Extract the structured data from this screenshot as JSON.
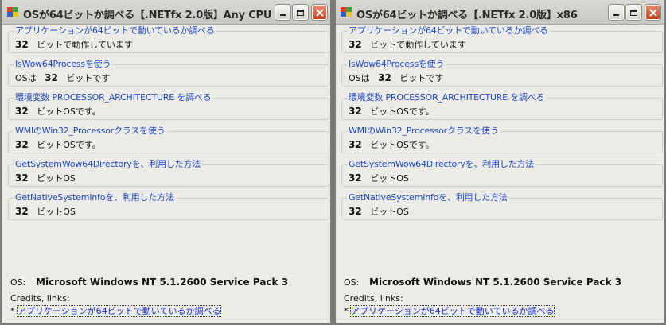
{
  "windows": [
    {
      "title": "OSが64ビットか調べる【.NETfx 2.0版】Any CPU",
      "groups": [
        {
          "label": "アプリケーションが64ビットで動いているか調べる",
          "prefix": "",
          "num": "32",
          "suffix": "ビットで動作しています"
        },
        {
          "label": "IsWow64Processを使う",
          "prefix": "OSは",
          "num": "32",
          "suffix": "ビットです"
        },
        {
          "label": "環境変数 PROCESSOR_ARCHITECTURE を調べる",
          "prefix": "",
          "num": "32",
          "suffix": "ビットOSです。"
        },
        {
          "label": "WMIのWin32_Processorクラスを使う",
          "prefix": "",
          "num": "32",
          "suffix": "ビットOSです。"
        },
        {
          "label": "GetSystemWow64Directoryを、利用した方法",
          "prefix": "",
          "num": "32",
          "suffix": "ビットOS"
        },
        {
          "label": "GetNativeSystemInfoを、利用した方法",
          "prefix": "",
          "num": "32",
          "suffix": "ビットOS"
        }
      ],
      "os_label": "OS:",
      "os_value": "Microsoft Windows NT 5.1.2600 Service Pack 3",
      "credits_label": "Credits, links:",
      "credit_bullet": "*",
      "credit_link": "アプリケーションが64ビットで動いているか調べる"
    },
    {
      "title": "OSが64ビットか調べる【.NETfx 2.0版】x86",
      "groups": [
        {
          "label": "アプリケーションが64ビットで動いているか調べる",
          "prefix": "",
          "num": "32",
          "suffix": "ビットで動作しています"
        },
        {
          "label": "IsWow64Processを使う",
          "prefix": "OSは",
          "num": "32",
          "suffix": "ビットです"
        },
        {
          "label": "環境変数 PROCESSOR_ARCHITECTURE を調べる",
          "prefix": "",
          "num": "32",
          "suffix": "ビットOSです。"
        },
        {
          "label": "WMIのWin32_Processorクラスを使う",
          "prefix": "",
          "num": "32",
          "suffix": "ビットOSです。"
        },
        {
          "label": "GetSystemWow64Directoryを、利用した方法",
          "prefix": "",
          "num": "32",
          "suffix": "ビットOS"
        },
        {
          "label": "GetNativeSystemInfoを、利用した方法",
          "prefix": "",
          "num": "32",
          "suffix": "ビットOS"
        }
      ],
      "os_label": "OS:",
      "os_value": "Microsoft Windows NT 5.1.2600 Service Pack 3",
      "credits_label": "Credits, links:",
      "credit_bullet": "*",
      "credit_link": "アプリケーションが64ビットで動いているか調べる"
    }
  ],
  "colors": {
    "group_label": "#1b48c4",
    "link": "#1a2fd0",
    "window_bg": "#ecebe5",
    "close_button": "#c4401e"
  },
  "icons": {
    "app": "app-window-icon",
    "minimize": "minimize-icon",
    "maximize": "maximize-icon",
    "close": "close-icon"
  }
}
